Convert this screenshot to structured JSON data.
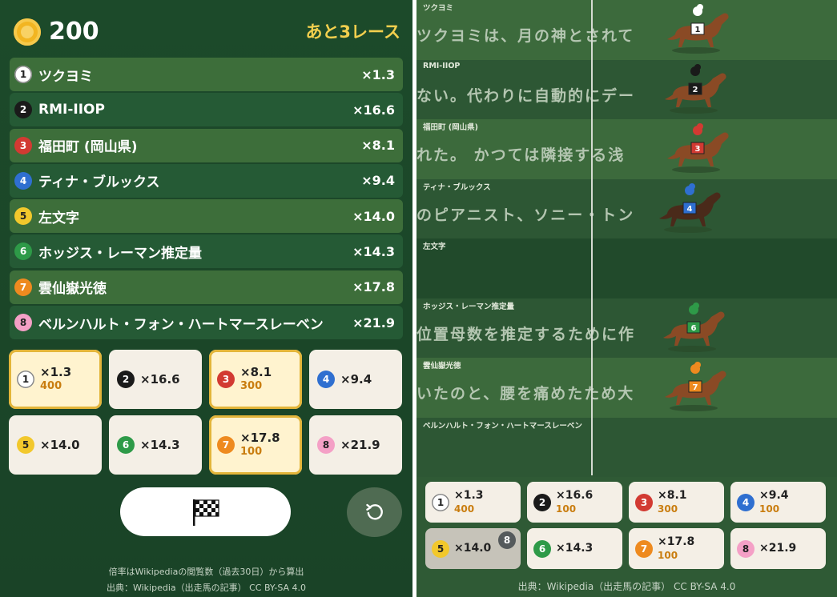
{
  "header": {
    "coins": "200",
    "races_left": "あと3レース"
  },
  "horses": [
    {
      "no": "1",
      "name": "ツクヨミ",
      "odds": "×1.3",
      "color": "#ffffff",
      "textColor": "#222222",
      "shade": "light"
    },
    {
      "no": "2",
      "name": "RMI-IIOP",
      "odds": "×16.6",
      "color": "#1a1a1a",
      "textColor": "#ffffff",
      "shade": "dark"
    },
    {
      "no": "3",
      "name": "福田町 (岡山県)",
      "odds": "×8.1",
      "color": "#d23a32",
      "textColor": "#ffffff",
      "shade": "light"
    },
    {
      "no": "4",
      "name": "ティナ・ブルックス",
      "odds": "×9.4",
      "color": "#2f6fd0",
      "textColor": "#ffffff",
      "shade": "dark"
    },
    {
      "no": "5",
      "name": "左文字",
      "odds": "×14.0",
      "color": "#f2c82c",
      "textColor": "#222222",
      "shade": "light"
    },
    {
      "no": "6",
      "name": "ホッジス・レーマン推定量",
      "odds": "×14.3",
      "color": "#2e9a48",
      "textColor": "#ffffff",
      "shade": "dark"
    },
    {
      "no": "7",
      "name": "雲仙嶽光徳",
      "odds": "×17.8",
      "color": "#ee8a1f",
      "textColor": "#ffffff",
      "shade": "light"
    },
    {
      "no": "8",
      "name": "ベルンハルト・フォン・ハートマースレーベン",
      "odds": "×21.9",
      "color": "#f4a0c6",
      "textColor": "#222222",
      "shade": "dark"
    }
  ],
  "bets_left": [
    {
      "no": "1",
      "odds": "×1.3",
      "amount": "400",
      "selected": true
    },
    {
      "no": "2",
      "odds": "×16.6",
      "amount": "",
      "selected": false
    },
    {
      "no": "3",
      "odds": "×8.1",
      "amount": "300",
      "selected": true
    },
    {
      "no": "4",
      "odds": "×9.4",
      "amount": "",
      "selected": false
    },
    {
      "no": "5",
      "odds": "×14.0",
      "amount": "",
      "selected": false
    },
    {
      "no": "6",
      "odds": "×14.3",
      "amount": "",
      "selected": false
    },
    {
      "no": "7",
      "odds": "×17.8",
      "amount": "100",
      "selected": true
    },
    {
      "no": "8",
      "odds": "×21.9",
      "amount": "",
      "selected": false
    }
  ],
  "controls": {
    "start_icon": "checkered-flag-icon",
    "reset_icon": "reset-icon"
  },
  "footer_left": {
    "note": "倍率はWikipediaの閲覧数（過去30日）から算出",
    "source": "出典：Wikipedia（出走馬の記事） CC BY-SA 4.0"
  },
  "race": {
    "lanes": [
      {
        "label": "ツクヨミ",
        "text": "ツクヨミは、月の神とされて",
        "no": "1",
        "shade": "a",
        "horse": true
      },
      {
        "label": "RMI-IIOP",
        "text": "ない。代わりに自動的にデー",
        "no": "2",
        "shade": "b",
        "horse": true
      },
      {
        "label": "福田町 (岡山県)",
        "text": "れた。 かつては隣接する浅",
        "no": "3",
        "shade": "a",
        "horse": true
      },
      {
        "label": "ティナ・ブルックス",
        "text": "のピアニスト、ソニー・トン",
        "no": "4",
        "shade": "b",
        "horse": true
      },
      {
        "label": "左文字",
        "text": "",
        "no": "5",
        "shade": "dk",
        "horse": false
      },
      {
        "label": "ホッジス・レーマン推定量",
        "text": "位置母数を推定するために作",
        "no": "6",
        "shade": "b",
        "horse": true
      },
      {
        "label": "雲仙嶽光徳",
        "text": "いたのと、腰を痛めたため大",
        "no": "7",
        "shade": "a",
        "horse": true
      },
      {
        "label": "ベルンハルト・フォン・ハートマースレーベン",
        "text": "",
        "no": "8",
        "shade": "b",
        "horse": false
      }
    ]
  },
  "bets_right": [
    {
      "no": "1",
      "odds": "×1.3",
      "amount": "400",
      "dim": false,
      "rank": ""
    },
    {
      "no": "2",
      "odds": "×16.6",
      "amount": "100",
      "dim": false,
      "rank": ""
    },
    {
      "no": "3",
      "odds": "×8.1",
      "amount": "300",
      "dim": false,
      "rank": ""
    },
    {
      "no": "4",
      "odds": "×9.4",
      "amount": "100",
      "dim": false,
      "rank": ""
    },
    {
      "no": "5",
      "odds": "×14.0",
      "amount": "",
      "dim": true,
      "rank": "8"
    },
    {
      "no": "6",
      "odds": "×14.3",
      "amount": "",
      "dim": false,
      "rank": ""
    },
    {
      "no": "7",
      "odds": "×17.8",
      "amount": "100",
      "dim": false,
      "rank": ""
    },
    {
      "no": "8",
      "odds": "×21.9",
      "amount": "",
      "dim": false,
      "rank": ""
    }
  ],
  "footer_right": {
    "source": "出典：Wikipedia（出走馬の記事） CC BY-SA 4.0"
  }
}
